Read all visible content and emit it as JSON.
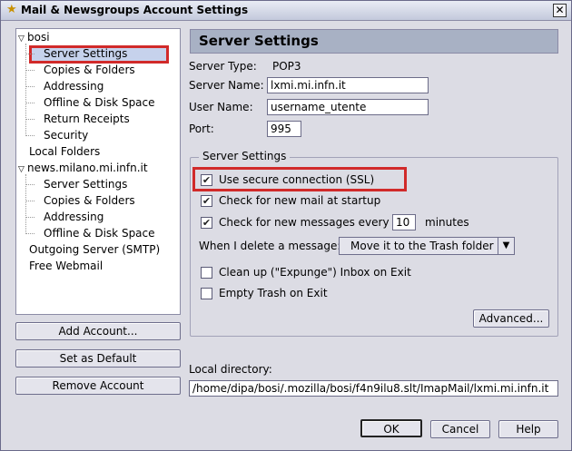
{
  "window": {
    "title": "Mail & Newsgroups Account Settings",
    "close_glyph": "✕"
  },
  "tree": {
    "items": [
      {
        "label": "bosi",
        "type": "account"
      },
      {
        "label": "Server Settings",
        "type": "child"
      },
      {
        "label": "Copies & Folders",
        "type": "child"
      },
      {
        "label": "Addressing",
        "type": "child"
      },
      {
        "label": "Offline & Disk Space",
        "type": "child"
      },
      {
        "label": "Return Receipts",
        "type": "child"
      },
      {
        "label": "Security",
        "type": "child"
      },
      {
        "label": "Local Folders",
        "type": "account"
      },
      {
        "label": "news.milano.mi.infn.it",
        "type": "account"
      },
      {
        "label": "Server Settings",
        "type": "child"
      },
      {
        "label": "Copies & Folders",
        "type": "child"
      },
      {
        "label": "Addressing",
        "type": "child"
      },
      {
        "label": "Offline & Disk Space",
        "type": "child"
      },
      {
        "label": "Outgoing Server (SMTP)",
        "type": "account"
      },
      {
        "label": "Free Webmail",
        "type": "account"
      }
    ]
  },
  "left_buttons": {
    "add_account": "Add Account...",
    "set_default": "Set as Default",
    "remove_account": "Remove Account"
  },
  "panel": {
    "title": "Server Settings",
    "server_type_label": "Server Type:",
    "server_type_value": "POP3",
    "server_name_label": "Server Name:",
    "server_name_value": "lxmi.mi.infn.it",
    "user_name_label": "User Name:",
    "user_name_value": "username_utente",
    "port_label": "Port:",
    "port_value": "995",
    "group_title": "Server Settings",
    "ssl_label": "Use secure connection (SSL)",
    "check_startup_label": "Check for new mail at startup",
    "check_every_label": "Check for new messages every",
    "check_every_value": "10",
    "minutes_label": "minutes",
    "delete_label": "When I delete a message:",
    "delete_option": "Move it to the Trash folder",
    "cleanup_label": "Clean up (\"Expunge\") Inbox on Exit",
    "empty_trash_label": "Empty Trash on Exit",
    "advanced_button": "Advanced...",
    "local_dir_label": "Local directory:",
    "local_dir_value": "/home/dipa/bosi/.mozilla/bosi/f4n9ilu8.slt/ImapMail/lxmi.mi.infn.it"
  },
  "footer": {
    "ok": "OK",
    "cancel": "Cancel",
    "help": "Help"
  },
  "checkboxes": {
    "ssl": true,
    "startup": true,
    "every": true,
    "cleanup": false,
    "empty_trash": false
  },
  "colors": {
    "highlight": "#d12a2a",
    "header": "#a8b1c4"
  }
}
